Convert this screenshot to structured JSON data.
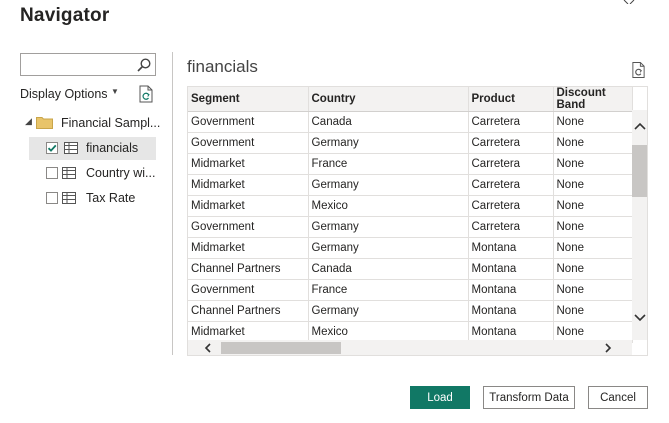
{
  "dialog": {
    "title": "Navigator"
  },
  "left_pane": {
    "search": {
      "value": "",
      "placeholder": ""
    },
    "display_options_label": "Display Options",
    "tree": {
      "root": {
        "label": "Financial Sampl...",
        "expanded": true
      },
      "items": [
        {
          "label": "financials",
          "checked": true,
          "selected": true
        },
        {
          "label": "Country wi...",
          "checked": false,
          "selected": false
        },
        {
          "label": "Tax Rate",
          "checked": false,
          "selected": false
        }
      ]
    }
  },
  "preview": {
    "title": "financials",
    "columns": [
      "Segment",
      "Country",
      "Product",
      "Discount Band"
    ],
    "rows": [
      [
        "Government",
        "Canada",
        "Carretera",
        "None"
      ],
      [
        "Government",
        "Germany",
        "Carretera",
        "None"
      ],
      [
        "Midmarket",
        "France",
        "Carretera",
        "None"
      ],
      [
        "Midmarket",
        "Germany",
        "Carretera",
        "None"
      ],
      [
        "Midmarket",
        "Mexico",
        "Carretera",
        "None"
      ],
      [
        "Government",
        "Germany",
        "Carretera",
        "None"
      ],
      [
        "Midmarket",
        "Germany",
        "Montana",
        "None"
      ],
      [
        "Channel Partners",
        "Canada",
        "Montana",
        "None"
      ],
      [
        "Government",
        "France",
        "Montana",
        "None"
      ],
      [
        "Channel Partners",
        "Germany",
        "Montana",
        "None"
      ],
      [
        "Midmarket",
        "Mexico",
        "Montana",
        "None"
      ]
    ]
  },
  "footer": {
    "load_label": "Load",
    "transform_label": "Transform Data",
    "cancel_label": "Cancel"
  },
  "colors": {
    "primary": "#117865",
    "selected_row": "#e6e6e6",
    "folder": "#e8c46a",
    "check": "#117865"
  }
}
